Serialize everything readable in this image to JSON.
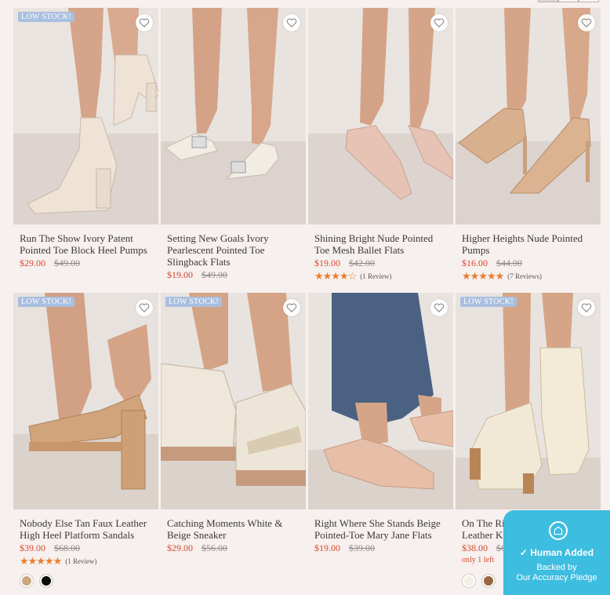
{
  "products": [
    {
      "badge": "LOW STOCK!",
      "name": "Run The Show Ivory Patent Pointed Toe Block Heel Pumps",
      "price": "$29.00",
      "compare": "$49.00",
      "stars": "",
      "reviews": "",
      "note": "",
      "swatches": []
    },
    {
      "badge": "",
      "name": "Setting New Goals Ivory Pearlescent Pointed Toe Slingback Flats",
      "price": "$19.00",
      "compare": "$49.00",
      "stars": "",
      "reviews": "",
      "note": "",
      "swatches": []
    },
    {
      "badge": "",
      "name": "Shining Bright Nude Pointed Toe Mesh Ballet Flats",
      "price": "$19.00",
      "compare": "$42.00",
      "stars": "★★★★☆",
      "reviews": "(1 Review)",
      "note": "",
      "swatches": []
    },
    {
      "badge": "",
      "name": "Higher Heights Nude Pointed Pumps",
      "price": "$16.00",
      "compare": "$44.00",
      "stars": "★★★★★",
      "reviews": "(7 Reviews)",
      "note": "",
      "swatches": []
    },
    {
      "badge": "LOW STOCK!",
      "name": "Nobody Else Tan Faux Leather High Heel Platform Sandals",
      "price": "$39.00",
      "compare": "$68.00",
      "stars": "★★★★★",
      "reviews": "(1 Review)",
      "note": "",
      "swatches": [
        "#c9a880",
        "#0b0b0b"
      ]
    },
    {
      "badge": "LOW STOCK!",
      "name": "Catching Moments White & Beige Sneaker",
      "price": "$29.00",
      "compare": "$56.00",
      "stars": "",
      "reviews": "",
      "note": "",
      "swatches": []
    },
    {
      "badge": "",
      "name": "Right Where She Stands Beige Pointed-Toe Mary Jane Flats",
      "price": "$19.00",
      "compare": "$39.00",
      "stars": "",
      "reviews": "",
      "note": "",
      "swatches": []
    },
    {
      "badge": "LOW STOCK!",
      "name": "On The Right Foot Ivory Faux Leather Knee High Boots",
      "price": "$38.00",
      "compare": "$62.00",
      "stars": "",
      "reviews": "",
      "note": "only 1 left",
      "swatches": [
        "#f4f1e4",
        "#9a6640"
      ]
    }
  ],
  "trust_badge": {
    "title": "Human Added",
    "line1": "Backed by",
    "line2": "Our Accuracy Pledge",
    "color": "#3dbde0"
  },
  "colors": {
    "sale": "#d8462f",
    "star": "#ea7e2f",
    "badge": "#a9bfdf",
    "background": "#f6f0ee"
  }
}
